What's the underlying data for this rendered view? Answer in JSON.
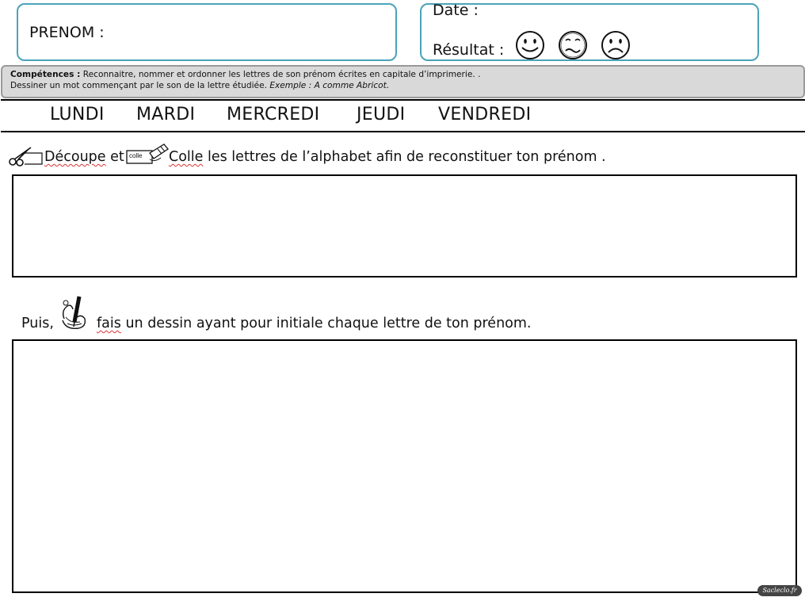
{
  "header": {
    "prenom_label": "PRENOM :",
    "date_label": "Date :",
    "result_label": "Résultat :",
    "smileys": [
      "happy-face-icon",
      "unsure-face-icon",
      "sad-face-icon"
    ]
  },
  "competences": {
    "title": "Compétences :",
    "line1": "Reconnaitre, nommer et ordonner les lettres de son prénom écrites en capitale d’imprimerie. .",
    "line2": "Dessiner un mot commençant par le son de la lettre étudiée.",
    "example": "Exemple : A comme Abricot."
  },
  "days": [
    "LUNDI",
    "MARDI",
    "MERCREDI",
    "JEUDI",
    "VENDREDI"
  ],
  "instruction1": {
    "word1": "Découpe",
    "middle": "et",
    "glue_label": "colle",
    "word2": "Colle",
    "rest": "les lettres de l’alphabet afin de reconstituer ton prénom ."
  },
  "instruction2": {
    "lead": "Puis,",
    "word": "fais",
    "rest": "un dessin ayant pour initiale chaque lettre de ton prénom."
  },
  "logo_text": "Sacleclo.fr",
  "colors": {
    "box_border": "#4aa3b8",
    "band_bg": "#d9d9d9",
    "spell_underline": "#d33"
  }
}
